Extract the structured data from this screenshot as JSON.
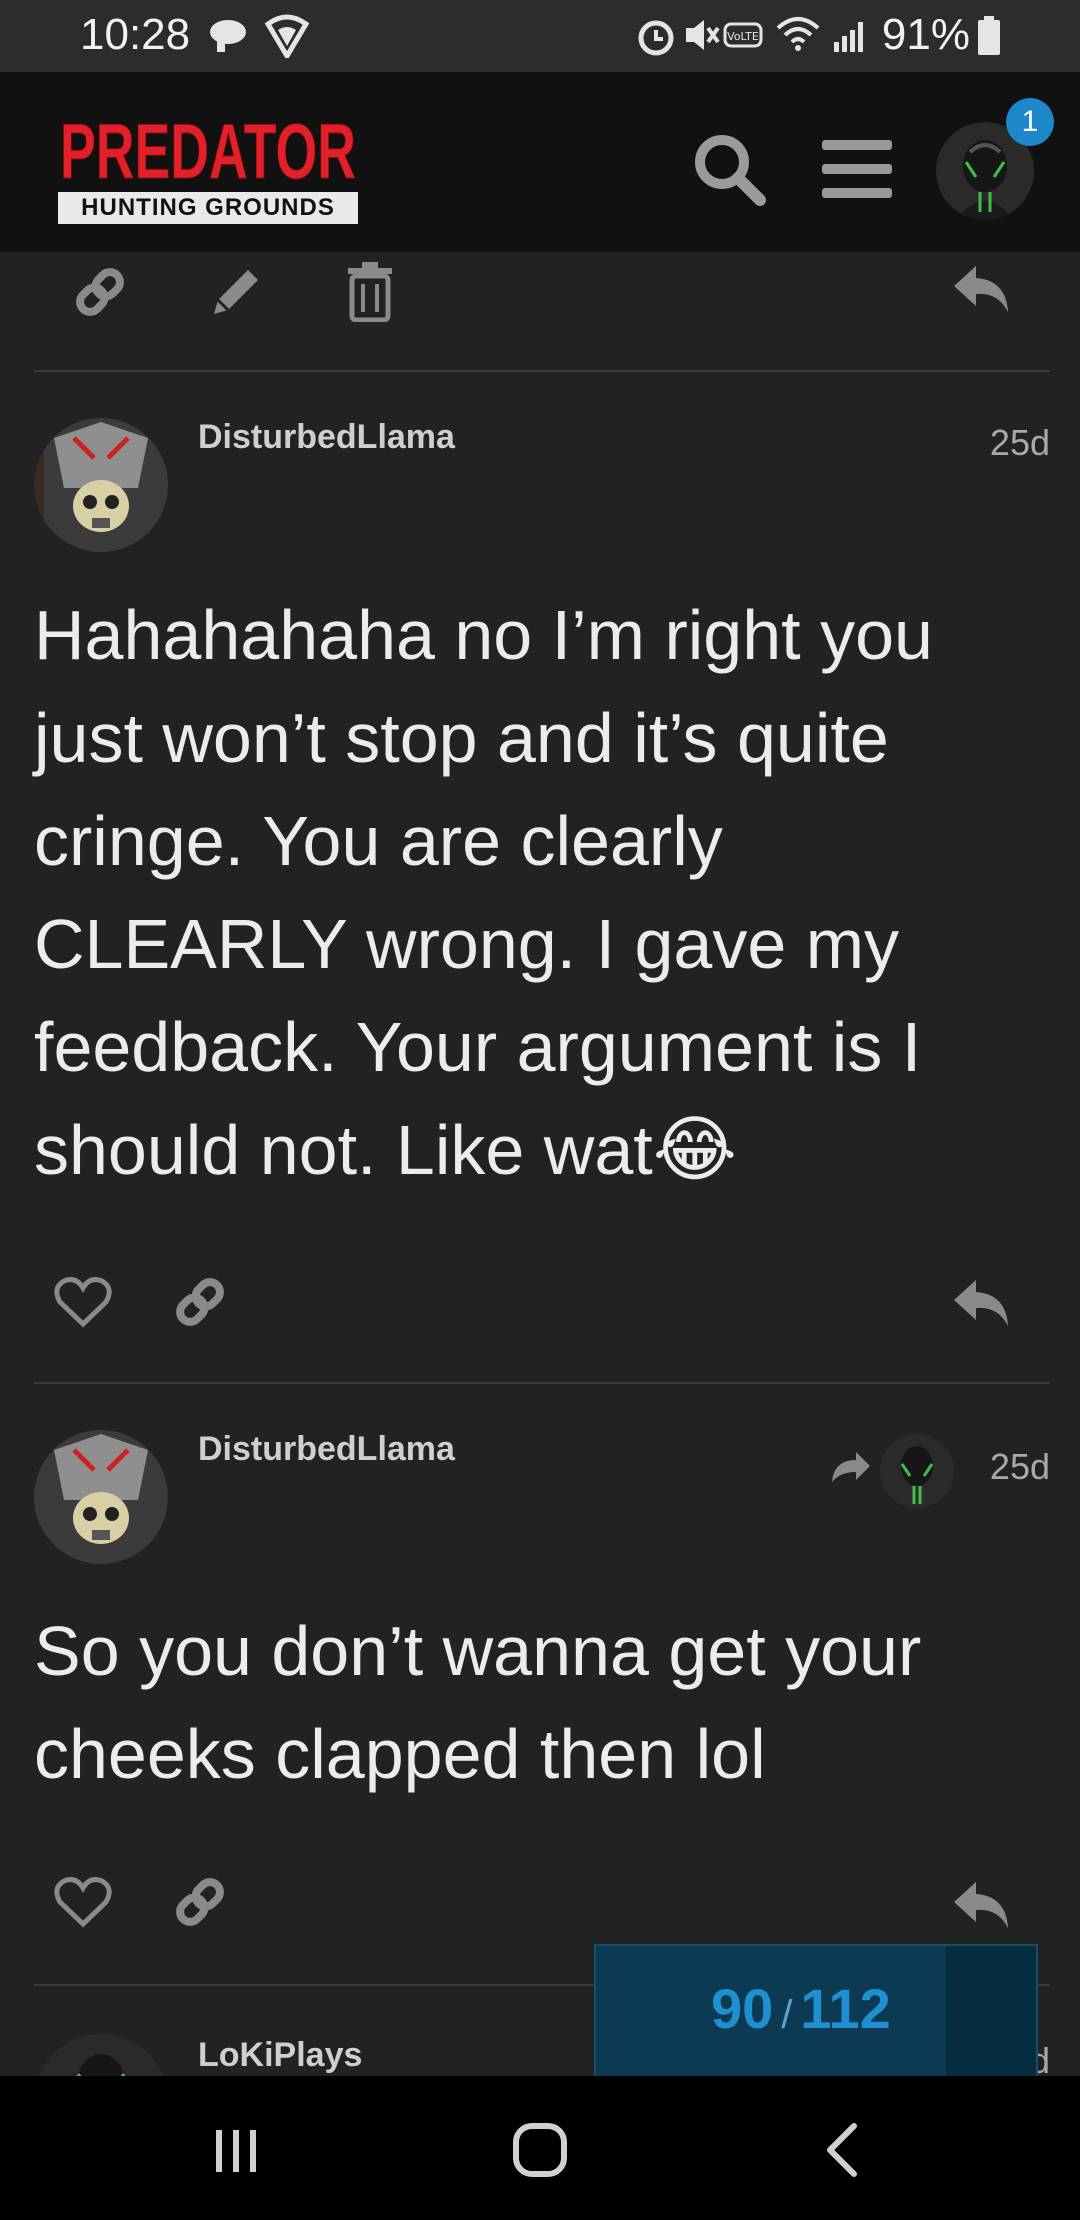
{
  "status_bar": {
    "time": "10:28",
    "battery": "91%",
    "icons": [
      "sync-icon",
      "wifi-shield-icon",
      "alarm-icon",
      "mute-icon",
      "volte-icon",
      "wifi-icon",
      "signal-icon",
      "battery-icon"
    ]
  },
  "header": {
    "logo_title": "PREDATOR",
    "logo_subtitle": "HUNTING GROUNDS",
    "notification_count": "1",
    "icons": [
      "search-icon",
      "hamburger-menu-icon",
      "user-avatar"
    ]
  },
  "top_actions": [
    "link-icon",
    "edit-icon",
    "delete-icon",
    "reply-icon"
  ],
  "posts": [
    {
      "username": "DisturbedLlama",
      "date": "25d",
      "body": "Hahahahaha no I’m right you just won’t stop and it’s quite cringe. You are clearly CLEARLY wrong. I gave my feedback. Your argument is I should not. Like wat",
      "emoji": "😂"
    },
    {
      "username": "DisturbedLlama",
      "date": "25d",
      "body": "So you don’t wanna get your cheeks clapped then lol"
    },
    {
      "username": "LoKiPlays",
      "date": "d"
    }
  ],
  "timeline": {
    "current": "90",
    "separator": "/",
    "total": "112"
  },
  "colors": {
    "background": "#222222",
    "header": "#111111",
    "accent": "#1c87c9",
    "logo_red": "#e1202a"
  }
}
